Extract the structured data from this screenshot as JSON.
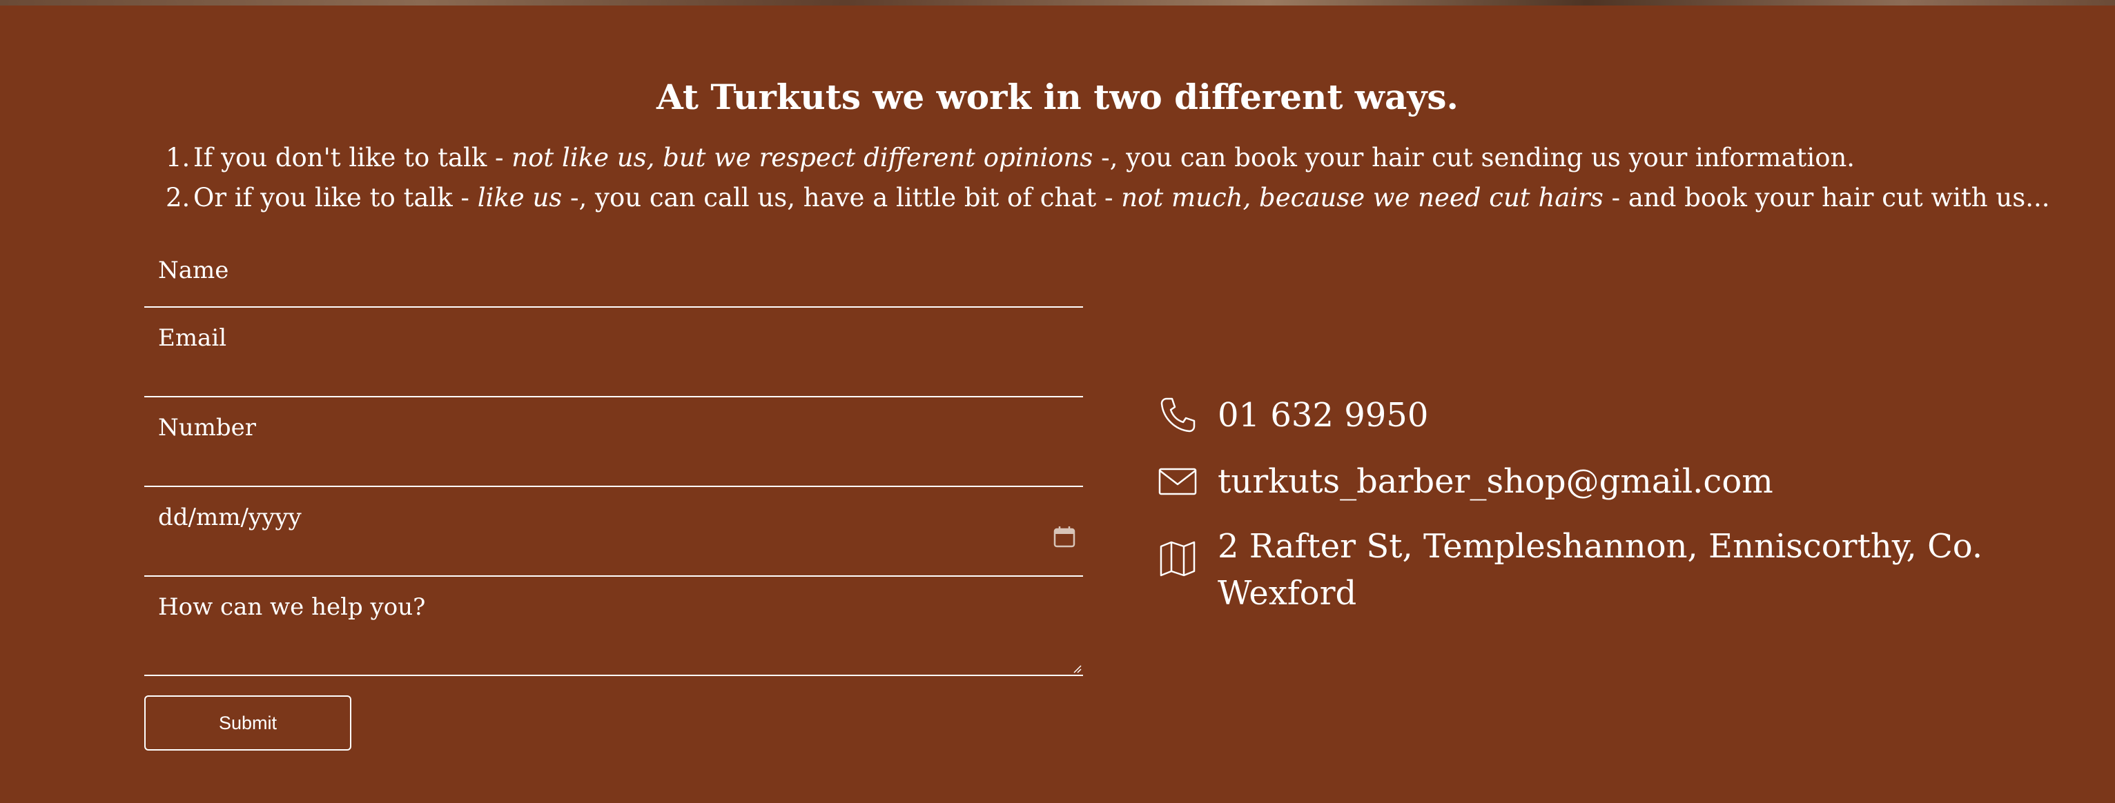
{
  "heading": "At Turkuts we work in two different ways.",
  "ways": [
    {
      "num": "1.",
      "part1": "If you don't like to talk - ",
      "em1": "not like us, but we respect different opinions",
      "part2": " -, you can book your hair cut sending us your information.",
      "em2": "",
      "part3": ""
    },
    {
      "num": "2.",
      "part1": "Or if you like to talk - ",
      "em1": "like us",
      "part2": " -, you can call us, have a little bit of chat - ",
      "em2": "not much, because we need cut hairs",
      "part3": " - and book your hair cut with us..."
    }
  ],
  "form": {
    "name_placeholder": "Name",
    "email_placeholder": "Email",
    "number_placeholder": "Number",
    "date_placeholder": "dd/mm/yyyy",
    "message_placeholder": "How can we help you?",
    "submit_label": "Submit"
  },
  "contact": {
    "phone": "01 632 9950",
    "email": "turkuts_barber_shop@gmail.com",
    "address": "2 Rafter St, Templeshannon, Enniscorthy, Co. Wexford"
  },
  "icons": {
    "phone": "phone-icon",
    "mail": "envelope-icon",
    "address": "map-icon",
    "date": "calendar-icon"
  },
  "colors": {
    "background": "#7b371a",
    "text": "#ffffff"
  }
}
